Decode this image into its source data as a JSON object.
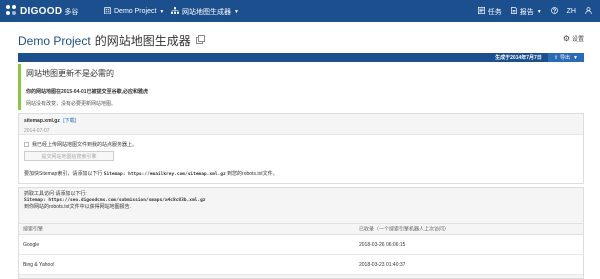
{
  "nav": {
    "logo_text": "DIGOOD",
    "logo_sub": "多谷",
    "project_label": "Demo Project",
    "project_icon": "building-icon",
    "tool_label": "网站地图生成器",
    "tool_icon": "sitemap-icon",
    "tasks_label": "任务",
    "reports_label": "报告",
    "lang_label": "ZH"
  },
  "header": {
    "title_project": "Demo Project",
    "title_suffix": "的网站地图生成器",
    "settings_label": "设置"
  },
  "statusbar": {
    "generated": "生成于2014年7月7日",
    "export_label": "导出"
  },
  "alert": {
    "title": "网站地图更新不是必需的",
    "strong": "你的网站地图在2015-04-01已被提交至谷歌,必应和雅虎",
    "note": "网站没有改变，没有必要更新网站地图。"
  },
  "sitemap": {
    "file_name": "sitemap.xml.gz",
    "download_label": "[下载]",
    "file_date": "2014-07-07",
    "checkbox_label": "我已经上传网站地图文件到我的站点服务器上。",
    "submit_label": "提交网站地图给搜索引擎",
    "instruction_prefix": "要加快Sitemap索引，请添加以下行",
    "instruction_code": "Sitemap: https://emailkrey.com/sitemap.xml.gz",
    "instruction_suffix": "到您的robots.txt文件。"
  },
  "submit_info": {
    "line1": "抓取工具访问 请添加以下行:",
    "line2": "Sitemap: https://seo.digoodcms.com/submission/smaps/a4c8c83b.xml.gz",
    "line3": "到你网站的robots.txt文件中以获得网站地图报告.",
    "columns": [
      "搜索引擎",
      "已收录（一个搜索引擎机器人上次访问）"
    ],
    "rows": [
      {
        "engine": "Google",
        "time": "2018-03-26 06:06:15"
      },
      {
        "engine": "Bing & Yahoo!",
        "time": "2018-03-23 01:40:37"
      }
    ]
  },
  "colors": {
    "nav_bg": "#1b4f8e",
    "alert_accent": "#8dc63f",
    "link": "#1b6fc2"
  }
}
